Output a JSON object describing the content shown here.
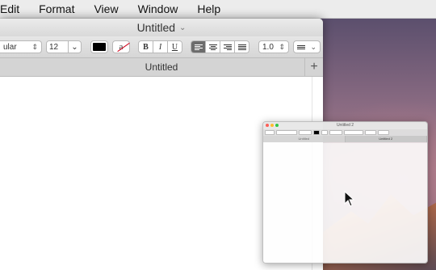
{
  "menubar": {
    "items": [
      "Edit",
      "Format",
      "View",
      "Window",
      "Help"
    ]
  },
  "window": {
    "title": "Untitled"
  },
  "toolbar": {
    "font_family": "ular",
    "font_size": "12",
    "style_bold": "B",
    "style_italic": "I",
    "style_underline": "U",
    "line_spacing": "1.0",
    "text_color": "#000000"
  },
  "tab_bar": {
    "tab_label": "Untitled",
    "add_tab": "+"
  },
  "thumbnail": {
    "title": "Untitled 2",
    "tabs": [
      "Untitled",
      "Untitled 2"
    ],
    "lights": [
      "#fc5f57",
      "#fdbc2e",
      "#33c748"
    ]
  }
}
